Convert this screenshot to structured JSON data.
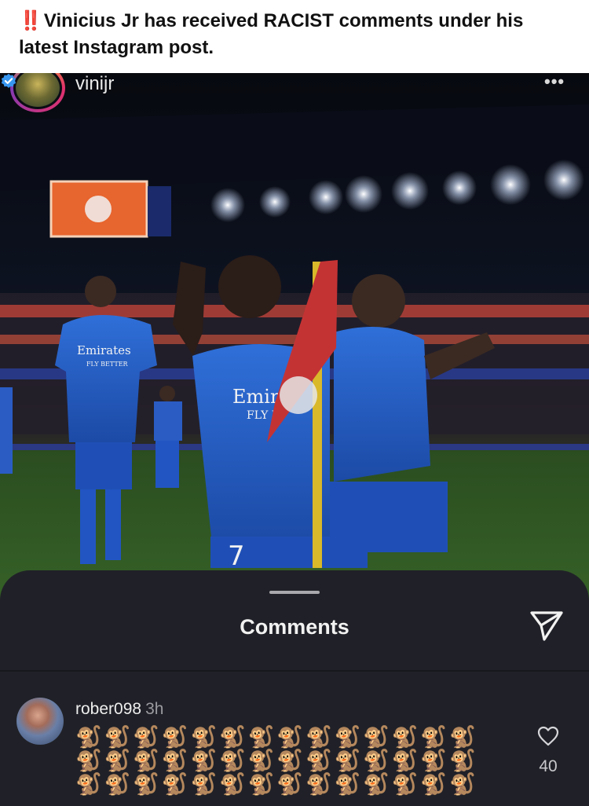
{
  "headline": {
    "marks": "‼️",
    "text": "Vinicius Jr has received RACIST comments under his latest Instagram post."
  },
  "post": {
    "username": "vinijr",
    "verified": true,
    "more_icon": "more-dots-icon"
  },
  "photo": {
    "jersey_front_text": "Emira",
    "jersey_front_sub": "FLY B",
    "jersey_left_text": "Emirates",
    "jersey_left_sub": "FLY BETTER",
    "shorts_number": "7"
  },
  "comments_sheet": {
    "title": "Comments",
    "share_icon": "send-icon"
  },
  "comment": {
    "username": "rober098",
    "time": "3h",
    "body": "🐒🐒🐒🐒🐒🐒🐒🐒🐒🐒🐒🐒🐒🐒🐒🐒🐒🐒🐒🐒🐒🐒🐒🐒🐒🐒🐒🐒🐒🐒🐒🐒🐒🐒🐒🐒🐒🐒🐒🐒🐒🐒",
    "like_icon": "heart-icon",
    "like_count": "40"
  },
  "colors": {
    "headline_marks": "#e0202a",
    "sheet_bg": "#202128",
    "verified_blue": "#3897f0"
  }
}
